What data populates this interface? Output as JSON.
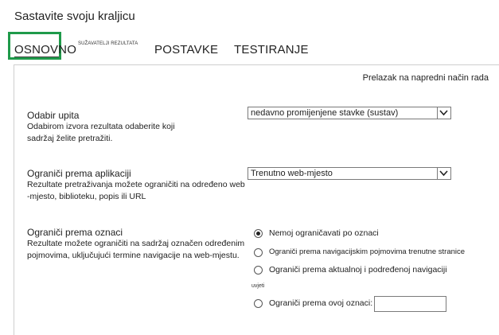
{
  "page": {
    "title": "Sastavite svoju kraljicu"
  },
  "tabs": [
    {
      "label": "OSNOVNO",
      "selected": true
    },
    {
      "label": "SUŽAVATELJI REZULTATA"
    },
    {
      "label": "POSTAVKE"
    },
    {
      "label": "TESTIRANJE"
    }
  ],
  "advanced_link": "Prelazak na napredni način rada",
  "query_section": {
    "title": "Odabir upita",
    "desc_line1": "Odabirom izvora rezultata odaberite koji",
    "desc_line2": "sadržaj želite pretražiti.",
    "selected": "nedavno promijenjene stavke (sustav)"
  },
  "app_section": {
    "title": "Ograniči prema aplikaciji",
    "desc_line1": "Rezultate pretraživanja možete ograničiti na određeno web",
    "desc_line2": "-mjesto, biblioteku, popis ili URL",
    "selected": "Trenutno web-mjesto"
  },
  "tag_section": {
    "title": "Ograniči prema oznaci",
    "desc_line1": "Rezultate možete ograničiti na sadržaj označen određenim",
    "desc_line2": "pojmovima, uključujući termine navigacije na web-mjestu.",
    "options": [
      {
        "label": "Nemoj ograničavati po oznaci",
        "checked": true
      },
      {
        "label": "Ograniči prema navigacijskim pojmovima trenutne stranice"
      },
      {
        "label": "Ograniči prema aktualnoj i podređenoj navigaciji"
      },
      {
        "label": "Ograniči prema ovoj oznaci:"
      }
    ],
    "condition_label": "uvjeti",
    "tag_input_value": ""
  }
}
